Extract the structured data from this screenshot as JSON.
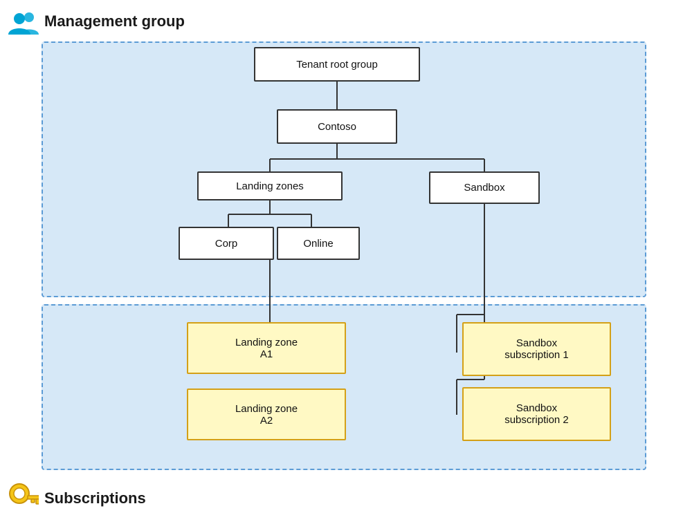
{
  "header": {
    "icon_label": "Management group",
    "icon_type": "users-icon"
  },
  "footer": {
    "icon_label": "Subscriptions",
    "icon_type": "key-icon"
  },
  "nodes": {
    "tenant_root": {
      "label": "Tenant root group"
    },
    "contoso": {
      "label": "Contoso"
    },
    "landing_zones": {
      "label": "Landing zones"
    },
    "sandbox": {
      "label": "Sandbox"
    },
    "corp": {
      "label": "Corp"
    },
    "online": {
      "label": "Online"
    },
    "lz_a1": {
      "label": "Landing zone\nA1"
    },
    "lz_a2": {
      "label": "Landing zone\nA2"
    },
    "sandbox_sub1": {
      "label": "Sandbox\nsubscription 1"
    },
    "sandbox_sub2": {
      "label": "Sandbox\nsubscription 2"
    }
  }
}
